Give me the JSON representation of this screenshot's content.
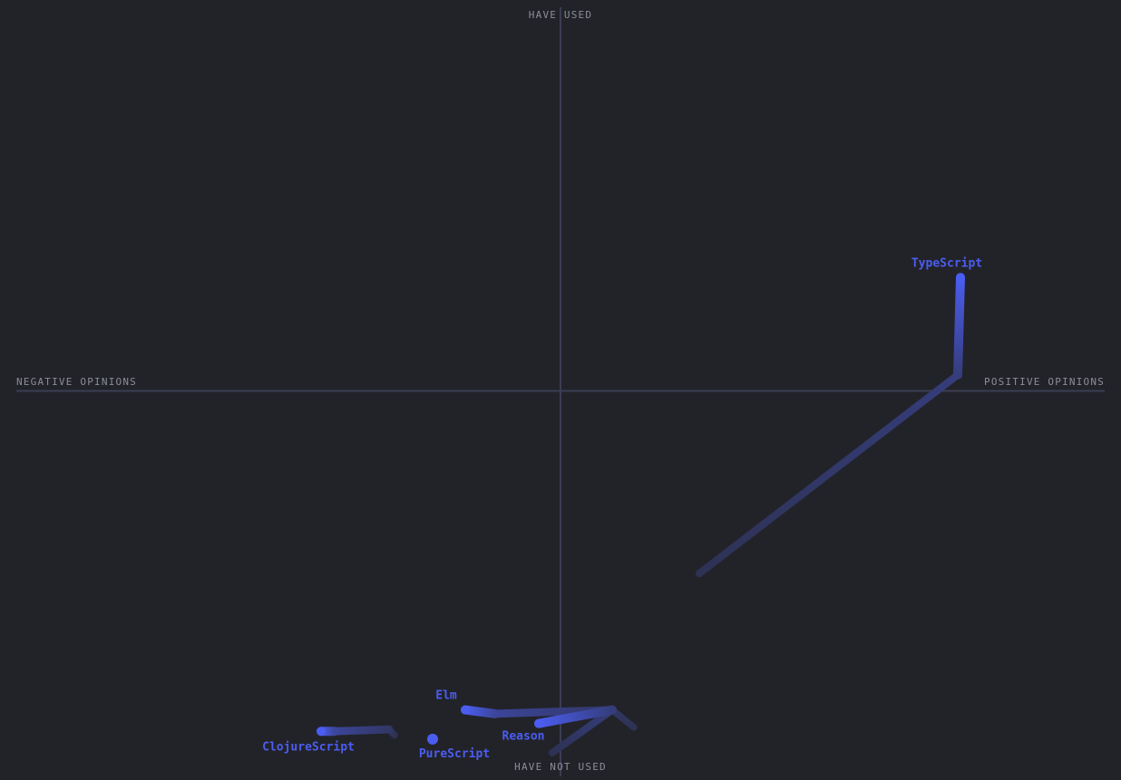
{
  "chart_data": {
    "type": "scatter",
    "xlim": [
      -100,
      100
    ],
    "ylim": [
      -100,
      100
    ],
    "grid": false,
    "legend": "none",
    "quadrant_labels": {
      "top": "HAVE USED",
      "bottom": "HAVE NOT USED",
      "left": "NEGATIVE OPINIONS",
      "right": "POSITIVE OPINIONS"
    },
    "series": [
      {
        "name": "TypeScript",
        "points": [
          {
            "x": 25.5,
            "y": -47
          },
          {
            "x": 73,
            "y": 4
          },
          {
            "x": 73.5,
            "y": 29
          }
        ]
      },
      {
        "name": "Elm",
        "points": [
          {
            "x": 13.5,
            "y": -86.5
          },
          {
            "x": 9.5,
            "y": -82
          },
          {
            "x": -12,
            "y": -83
          },
          {
            "x": -17.5,
            "y": -82
          }
        ]
      },
      {
        "name": "Reason",
        "points": [
          {
            "x": -1.5,
            "y": -93
          },
          {
            "x": 9.5,
            "y": -82
          },
          {
            "x": -4,
            "y": -85.5
          }
        ]
      },
      {
        "name": "ClojureScript",
        "points": [
          {
            "x": -30.5,
            "y": -88.5
          },
          {
            "x": -31.5,
            "y": -87
          },
          {
            "x": -41.5,
            "y": -87.5
          },
          {
            "x": -44,
            "y": -87.5
          }
        ]
      },
      {
        "name": "PureScript",
        "points": [
          {
            "x": -23.5,
            "y": -89.5
          }
        ]
      }
    ],
    "colors": {
      "accent": "#4b5df0",
      "faded": "#2e3254",
      "axis": "#3b3d52",
      "axis_label": "#8b8d98",
      "background": "#222329"
    }
  }
}
